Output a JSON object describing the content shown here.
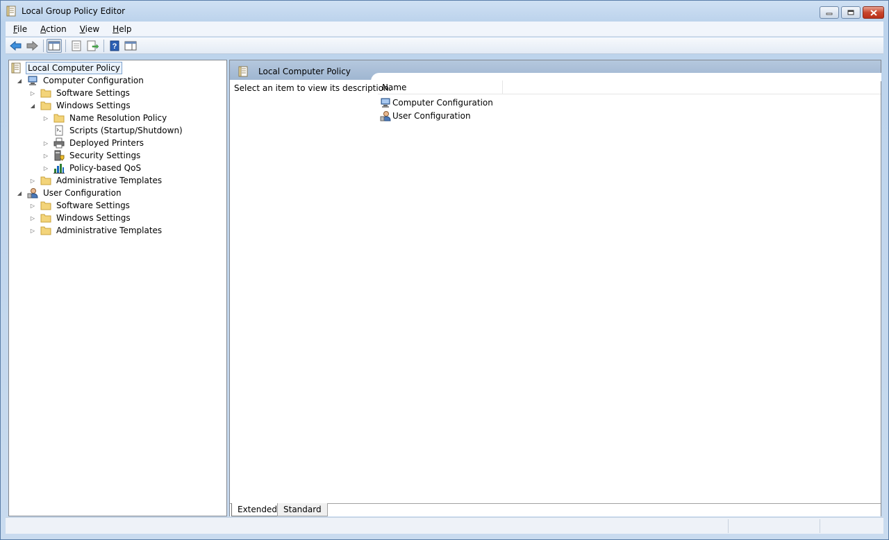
{
  "window": {
    "title": "Local Group Policy Editor",
    "minimize_label": "▭",
    "maximize_label": "□",
    "close_label": "✕"
  },
  "menu": {
    "items": [
      {
        "underline": "F",
        "rest": "ile"
      },
      {
        "underline": "A",
        "rest": "ction"
      },
      {
        "underline": "V",
        "rest": "iew"
      },
      {
        "underline": "H",
        "rest": "elp"
      }
    ]
  },
  "toolbar": {
    "buttons": [
      "back-arrow-icon",
      "forward-arrow-icon",
      "show-hide-console-tree-icon",
      "properties-icon",
      "export-list-icon",
      "help-icon",
      "show-hide-action-pane-icon"
    ]
  },
  "tree": {
    "items": [
      {
        "label": "Local Computer Policy"
      },
      {
        "label": "Computer Configuration"
      },
      {
        "label": "Software Settings"
      },
      {
        "label": "Windows Settings"
      },
      {
        "label": "Name Resolution Policy"
      },
      {
        "label": "Scripts (Startup/Shutdown)"
      },
      {
        "label": "Deployed Printers"
      },
      {
        "label": "Security Settings"
      },
      {
        "label": "Policy-based QoS"
      },
      {
        "label": "Administrative Templates"
      },
      {
        "label": "User Configuration"
      },
      {
        "label": "Software Settings"
      },
      {
        "label": "Windows Settings"
      },
      {
        "label": "Administrative Templates"
      }
    ]
  },
  "details": {
    "header_title": "Local Computer Policy",
    "description": "Select an item to view its description.",
    "column_name": "Name",
    "rows": [
      {
        "label": "Computer Configuration"
      },
      {
        "label": "User Configuration"
      }
    ]
  },
  "tabs": {
    "extended": "Extended",
    "standard": "Standard"
  },
  "colors": {
    "accent_header": "#a9bfd9",
    "window_frame": "#bcd3ec",
    "folder": "#f3d47a"
  }
}
